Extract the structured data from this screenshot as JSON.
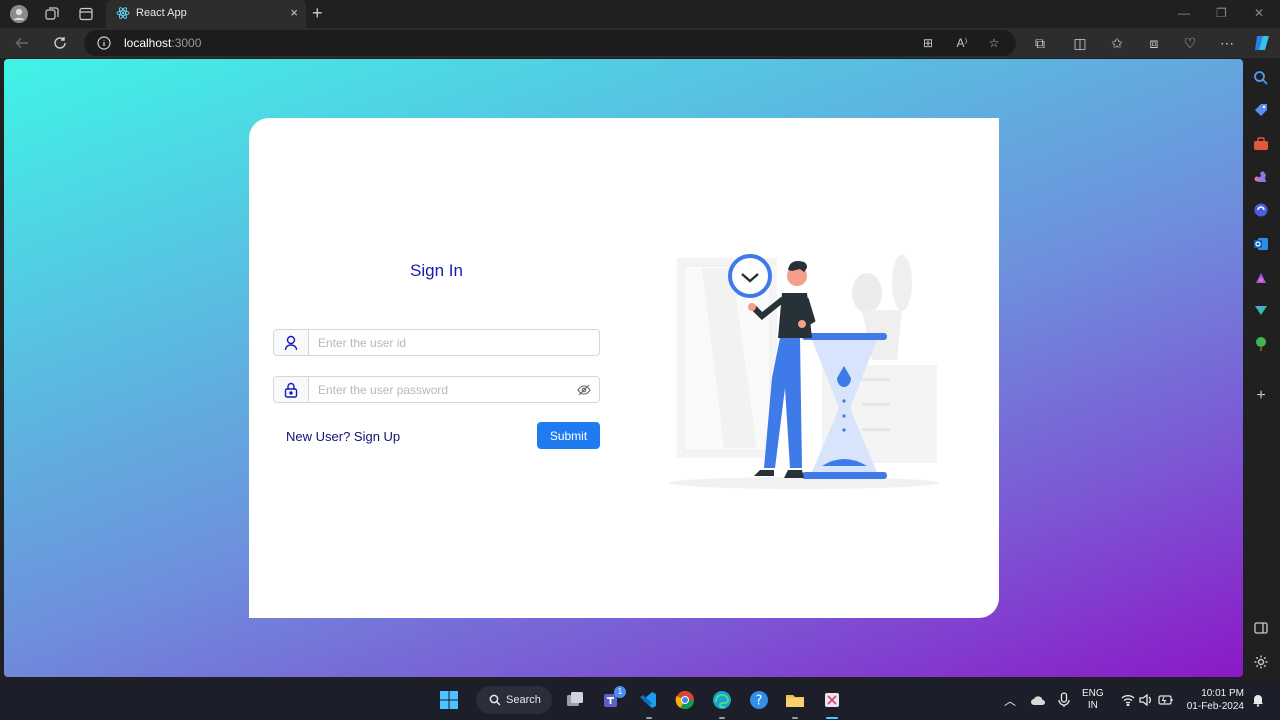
{
  "browser": {
    "tab_title": "React App",
    "tab_close": "×",
    "new_tab": "+",
    "url_host": "localhost",
    "url_port": ":3000"
  },
  "page": {
    "title": "Sign In",
    "userid_placeholder": "Enter the user id",
    "password_placeholder": "Enter the user password",
    "signup_link": "New User? Sign Up",
    "submit_label": "Submit"
  },
  "taskbar": {
    "search_label": "Search",
    "teams_badge": "1",
    "lang_line1": "ENG",
    "lang_line2": "IN",
    "time": "10:01 PM",
    "date": "01-Feb-2024"
  },
  "colors": {
    "accent": "#1f7cf0",
    "title": "#1a1ab3",
    "link": "#11117a"
  }
}
